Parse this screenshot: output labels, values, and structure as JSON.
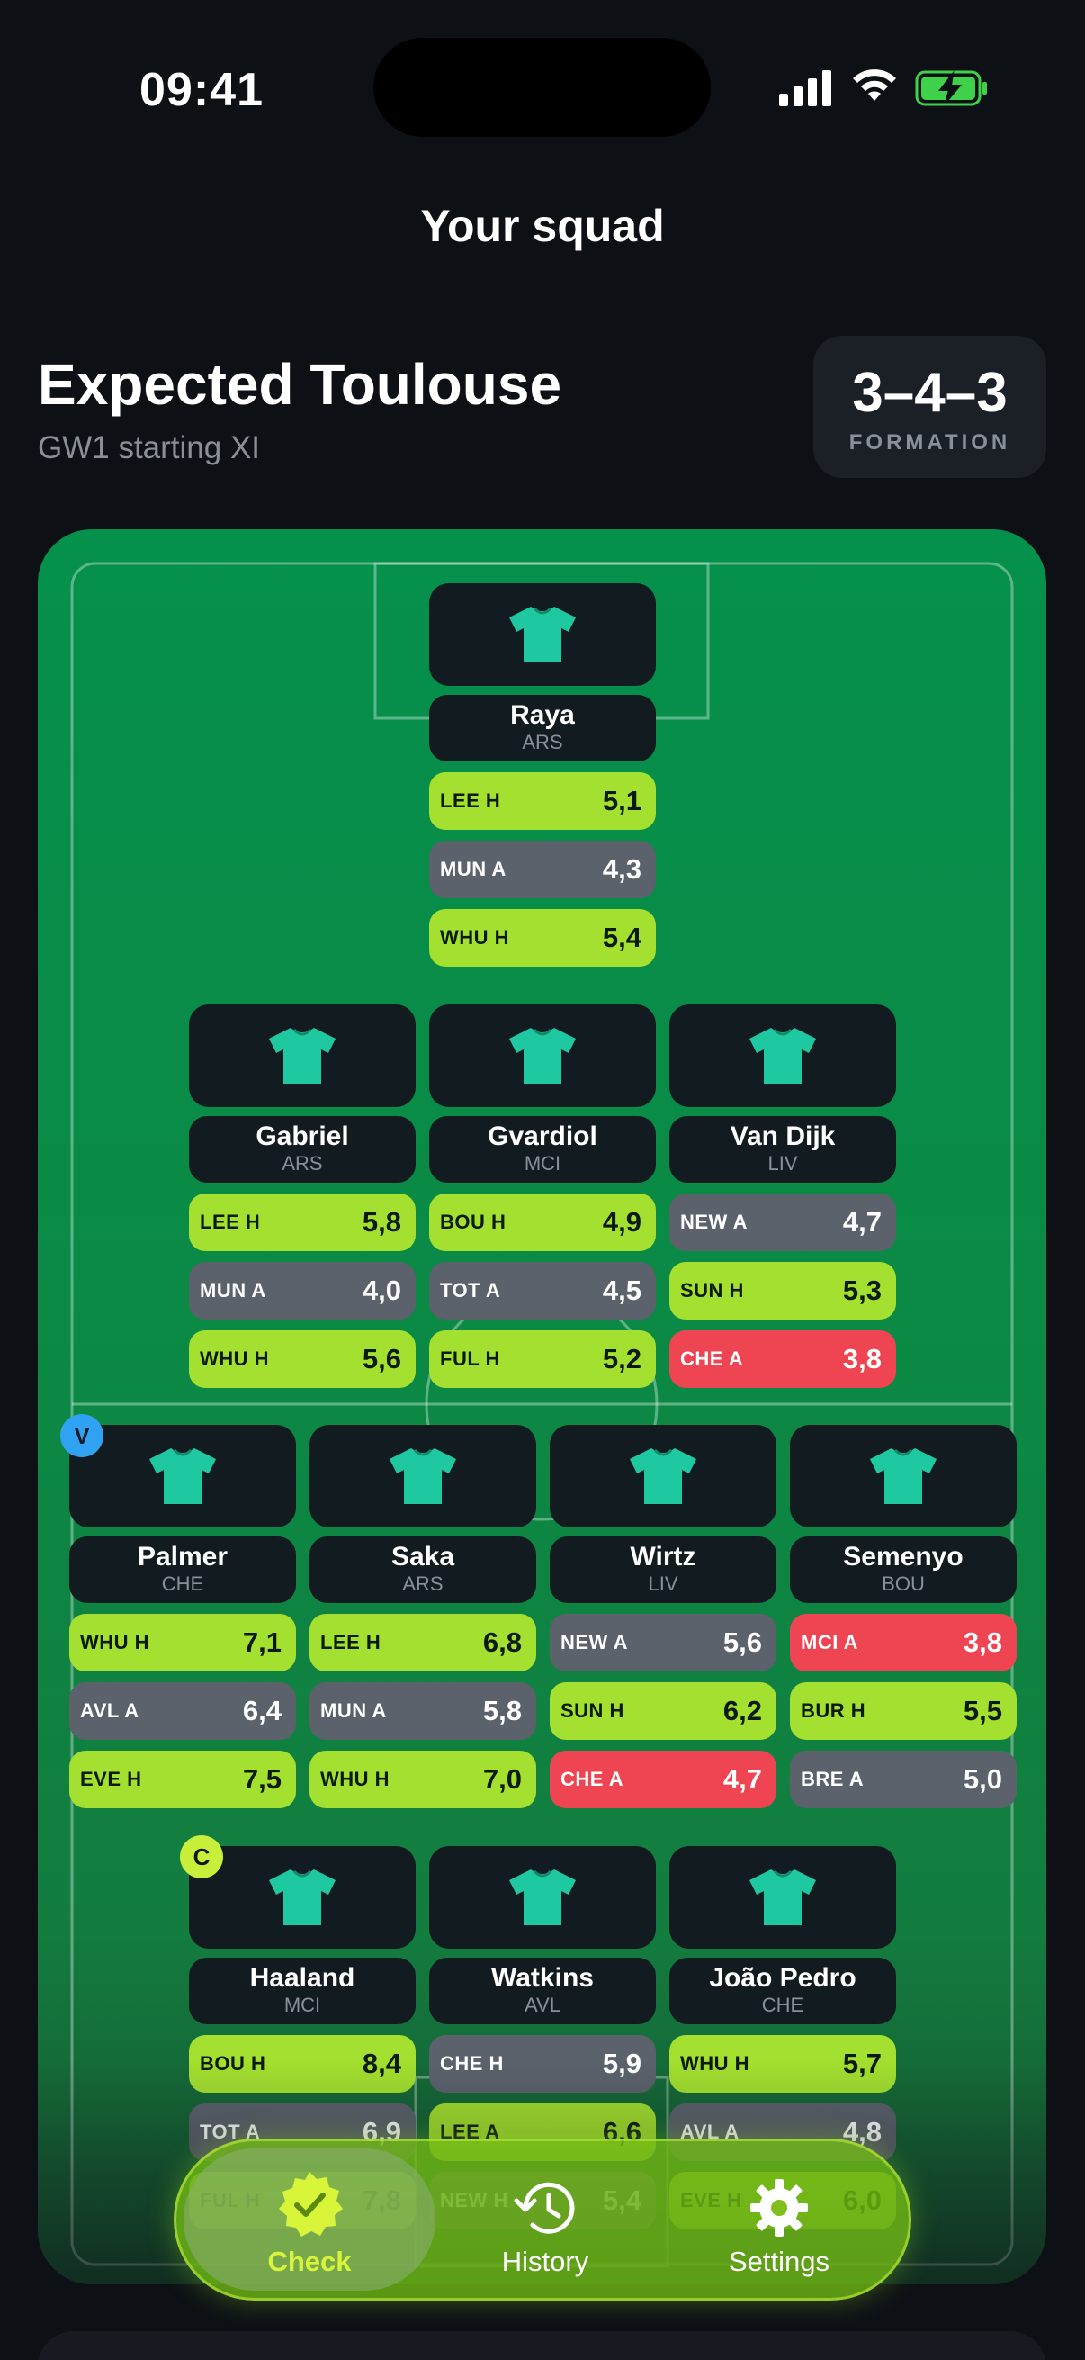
{
  "status": {
    "time": "09:41"
  },
  "header": {
    "title": "Your squad"
  },
  "team": {
    "name": "Expected Toulouse",
    "subtitle": "GW1 starting XI"
  },
  "formation": {
    "value": "3–4–3",
    "label": "FORMATION"
  },
  "colors": {
    "good": "#a3e02f",
    "neutral": "#5b626c",
    "bad": "#ef4452",
    "shirt": "#1ec8a0",
    "pitch": "#05904c"
  },
  "players": [
    {
      "name": "Raya",
      "team": "ARS",
      "fixtures": [
        {
          "t": "LEE H",
          "v": "5,1",
          "s": "g"
        },
        {
          "t": "MUN A",
          "v": "4,3",
          "s": "n"
        },
        {
          "t": "WHU H",
          "v": "5,4",
          "s": "g"
        }
      ]
    },
    {
      "name": "Gabriel",
      "team": "ARS",
      "fixtures": [
        {
          "t": "LEE H",
          "v": "5,8",
          "s": "g"
        },
        {
          "t": "MUN A",
          "v": "4,0",
          "s": "n"
        },
        {
          "t": "WHU H",
          "v": "5,6",
          "s": "g"
        }
      ]
    },
    {
      "name": "Gvardiol",
      "team": "MCI",
      "fixtures": [
        {
          "t": "BOU H",
          "v": "4,9",
          "s": "g"
        },
        {
          "t": "TOT A",
          "v": "4,5",
          "s": "n"
        },
        {
          "t": "FUL H",
          "v": "5,2",
          "s": "g"
        }
      ]
    },
    {
      "name": "Van Dijk",
      "team": "LIV",
      "fixtures": [
        {
          "t": "NEW A",
          "v": "4,7",
          "s": "n"
        },
        {
          "t": "SUN H",
          "v": "5,3",
          "s": "g"
        },
        {
          "t": "CHE A",
          "v": "3,8",
          "s": "r"
        }
      ]
    },
    {
      "name": "Palmer",
      "team": "CHE",
      "badge": "V",
      "fixtures": [
        {
          "t": "WHU H",
          "v": "7,1",
          "s": "g"
        },
        {
          "t": "AVL A",
          "v": "6,4",
          "s": "n"
        },
        {
          "t": "EVE H",
          "v": "7,5",
          "s": "g"
        }
      ]
    },
    {
      "name": "Saka",
      "team": "ARS",
      "fixtures": [
        {
          "t": "LEE H",
          "v": "6,8",
          "s": "g"
        },
        {
          "t": "MUN A",
          "v": "5,8",
          "s": "n"
        },
        {
          "t": "WHU H",
          "v": "7,0",
          "s": "g"
        }
      ]
    },
    {
      "name": "Wirtz",
      "team": "LIV",
      "fixtures": [
        {
          "t": "NEW A",
          "v": "5,6",
          "s": "n"
        },
        {
          "t": "SUN H",
          "v": "6,2",
          "s": "g"
        },
        {
          "t": "CHE A",
          "v": "4,7",
          "s": "r"
        }
      ]
    },
    {
      "name": "Semenyo",
      "team": "BOU",
      "fixtures": [
        {
          "t": "MCI A",
          "v": "3,8",
          "s": "r"
        },
        {
          "t": "BUR H",
          "v": "5,5",
          "s": "g"
        },
        {
          "t": "BRE A",
          "v": "5,0",
          "s": "n"
        }
      ]
    },
    {
      "name": "Haaland",
      "team": "MCI",
      "badge": "C",
      "fixtures": [
        {
          "t": "BOU H",
          "v": "8,4",
          "s": "g"
        },
        {
          "t": "TOT A",
          "v": "6,9",
          "s": "n"
        },
        {
          "t": "FUL H",
          "v": "7,8",
          "s": "g"
        }
      ]
    },
    {
      "name": "Watkins",
      "team": "AVL",
      "fixtures": [
        {
          "t": "CHE H",
          "v": "5,9",
          "s": "n"
        },
        {
          "t": "LEE A",
          "v": "6,6",
          "s": "g"
        },
        {
          "t": "NEW H",
          "v": "5,4",
          "s": "n"
        }
      ]
    },
    {
      "name": "João Pedro",
      "team": "CHE",
      "fixtures": [
        {
          "t": "WHU H",
          "v": "5,7",
          "s": "g"
        },
        {
          "t": "AVL A",
          "v": "4,8",
          "s": "n"
        },
        {
          "t": "EVE H",
          "v": "6,0",
          "s": "g"
        }
      ]
    }
  ],
  "tabbar": {
    "items": [
      {
        "label": "Check",
        "icon": "check-badge-icon",
        "active": true
      },
      {
        "label": "History",
        "icon": "history-icon",
        "active": false
      },
      {
        "label": "Settings",
        "icon": "gear-icon",
        "active": false
      }
    ]
  }
}
